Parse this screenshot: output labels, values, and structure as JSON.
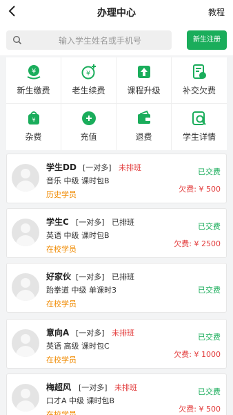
{
  "header": {
    "title": "办理中心",
    "right_label": "教程"
  },
  "search": {
    "placeholder": "输入学生姓名或手机号",
    "register_label": "新生注册"
  },
  "menu": [
    {
      "label": "新生缴费",
      "icon": "yen-hand-icon"
    },
    {
      "label": "老生续费",
      "icon": "yen-plus-icon"
    },
    {
      "label": "课程升级",
      "icon": "upgrade-arrow-icon"
    },
    {
      "label": "补交欠费",
      "icon": "document-pay-icon"
    },
    {
      "label": "杂费",
      "icon": "bag-icon"
    },
    {
      "label": "充值",
      "icon": "recharge-icon"
    },
    {
      "label": "退费",
      "icon": "wallet-refund-icon"
    },
    {
      "label": "学生详情",
      "icon": "student-search-icon"
    }
  ],
  "students": [
    {
      "name": "学生DD",
      "class_type": "[一对多]",
      "schedule": "未排班",
      "course": "音乐 中级 课时包B",
      "status": "历史学员",
      "paid": "已交费",
      "owed": "欠费: ¥ 500"
    },
    {
      "name": "学生C",
      "class_type": "[一对多]",
      "schedule": "已排班",
      "course": "英语 中级 课时包B",
      "status": "在校学员",
      "paid": "已交费",
      "owed": "欠费: ¥ 2500"
    },
    {
      "name": "好家伙",
      "class_type": "[一对多]",
      "schedule": "已排班",
      "course": "跆拳道 中级 单课时3",
      "status": "在校学员",
      "paid": "已交费",
      "owed": ""
    },
    {
      "name": "意向A",
      "class_type": "[一对多]",
      "schedule": "未排班",
      "course": "英语 高级 课时包C",
      "status": "在校学员",
      "paid": "已交费",
      "owed": "欠费: ¥ 1000"
    },
    {
      "name": "梅超风",
      "class_type": "[一对多]",
      "schedule": "未排班",
      "course": "口才A 中级 课时包B",
      "status": "在校学员",
      "paid": "已交费",
      "owed": "欠费: ¥ 500"
    }
  ],
  "colors": {
    "accent": "#1aad5b",
    "warning": "#f08a00",
    "danger": "#e23b3b"
  }
}
